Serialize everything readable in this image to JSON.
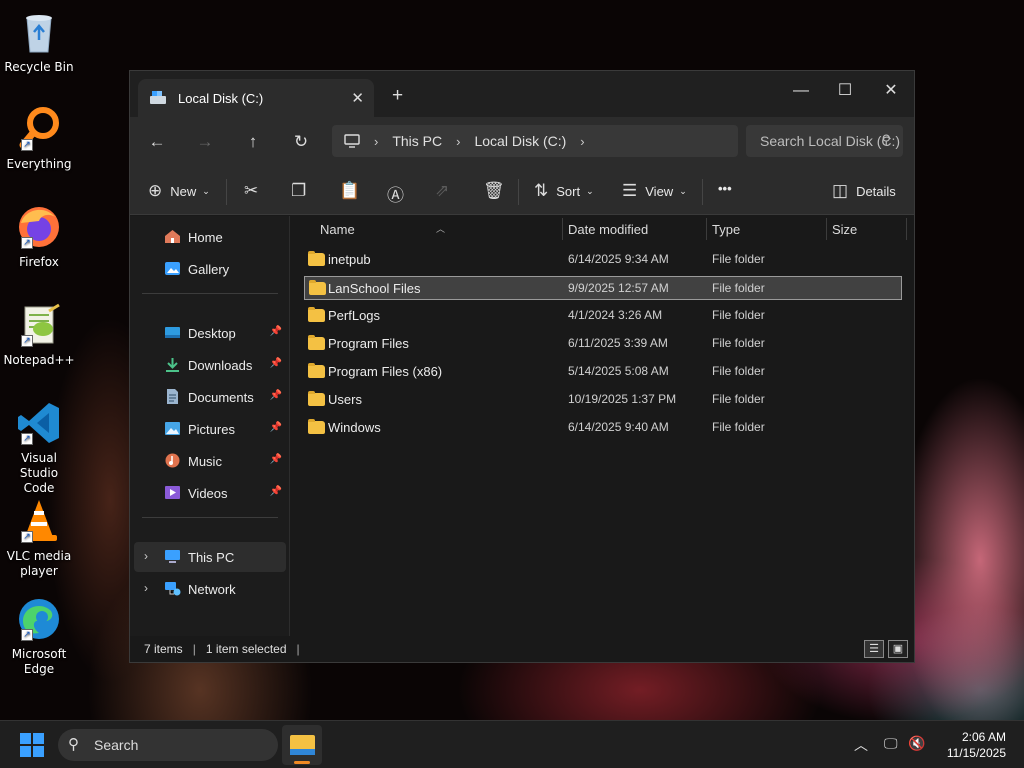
{
  "desktop": {
    "icons": [
      {
        "label": "Recycle Bin",
        "icon": "recycle-bin-icon"
      },
      {
        "label": "Everything",
        "icon": "everything-search-icon"
      },
      {
        "label": "Firefox",
        "icon": "firefox-icon"
      },
      {
        "label": "Notepad++",
        "icon": "notepad-plus-plus-icon"
      },
      {
        "label": "Visual Studio Code",
        "icon": "vscode-icon"
      },
      {
        "label": "VLC media player",
        "icon": "vlc-icon"
      },
      {
        "label": "Microsoft Edge",
        "icon": "edge-icon"
      }
    ]
  },
  "explorer": {
    "tab_title": "Local Disk (C:)",
    "new_tab_glyph": "+",
    "breadcrumb": [
      "This PC",
      "Local Disk (C:)"
    ],
    "search_placeholder": "Search Local Disk (C:)",
    "toolbar": {
      "new_label": "New",
      "sort_label": "Sort",
      "view_label": "View",
      "more_glyph": "•••",
      "details_label": "Details"
    },
    "sidebar": {
      "top": [
        {
          "label": "Home",
          "icon": "home-icon"
        },
        {
          "label": "Gallery",
          "icon": "gallery-icon"
        }
      ],
      "quick_access": [
        {
          "label": "Desktop",
          "icon": "desktop-folder-icon",
          "pinned": true
        },
        {
          "label": "Downloads",
          "icon": "downloads-icon",
          "pinned": true
        },
        {
          "label": "Documents",
          "icon": "documents-icon",
          "pinned": true
        },
        {
          "label": "Pictures",
          "icon": "pictures-icon",
          "pinned": true
        },
        {
          "label": "Music",
          "icon": "music-icon",
          "pinned": true
        },
        {
          "label": "Videos",
          "icon": "videos-icon",
          "pinned": true
        }
      ],
      "locations": [
        {
          "label": "This PC",
          "icon": "this-pc-icon",
          "active": true
        },
        {
          "label": "Network",
          "icon": "network-icon",
          "active": false
        }
      ]
    },
    "columns": {
      "name": "Name",
      "date": "Date modified",
      "type": "Type",
      "size": "Size"
    },
    "files": [
      {
        "name": "inetpub",
        "date": "6/14/2025 9:34 AM",
        "type": "File folder",
        "selected": false
      },
      {
        "name": "LanSchool Files",
        "date": "9/9/2025 12:57 AM",
        "type": "File folder",
        "selected": true
      },
      {
        "name": "PerfLogs",
        "date": "4/1/2024 3:26 AM",
        "type": "File folder",
        "selected": false
      },
      {
        "name": "Program Files",
        "date": "6/11/2025 3:39 AM",
        "type": "File folder",
        "selected": false
      },
      {
        "name": "Program Files (x86)",
        "date": "5/14/2025 5:08 AM",
        "type": "File folder",
        "selected": false
      },
      {
        "name": "Users",
        "date": "10/19/2025 1:37 PM",
        "type": "File folder",
        "selected": false
      },
      {
        "name": "Windows",
        "date": "6/14/2025 9:40 AM",
        "type": "File folder",
        "selected": false
      }
    ],
    "status": {
      "items": "7 items",
      "selected": "1 item selected"
    }
  },
  "taskbar": {
    "search_label": "Search",
    "time": "2:06 AM",
    "date": "11/15/2025"
  },
  "colors": {
    "folder": "#f4c143",
    "accent": "#3aa0ff",
    "window_bg": "#191919",
    "toolbar_bg": "#2c2c2c"
  }
}
